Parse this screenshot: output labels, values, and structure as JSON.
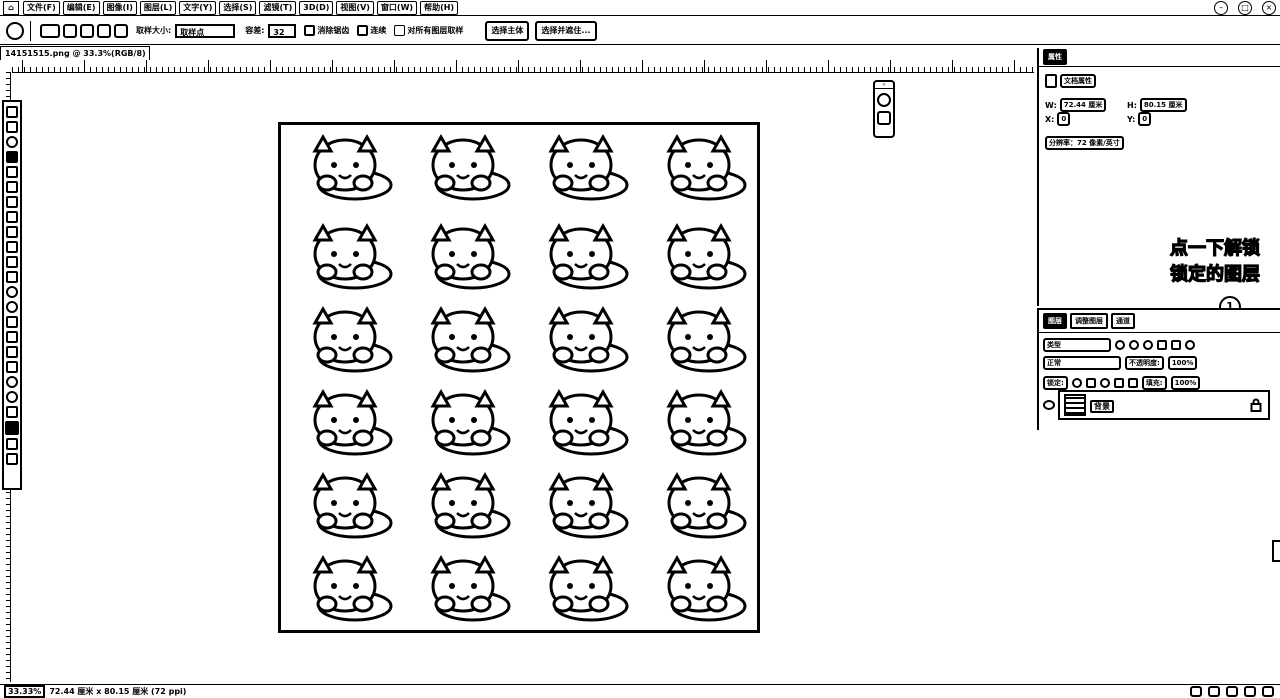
{
  "menubar": {
    "items": [
      "文件(F)",
      "编辑(E)",
      "图像(I)",
      "图层(L)",
      "文字(Y)",
      "选择(S)",
      "滤镜(T)",
      "3D(D)",
      "视图(V)",
      "窗口(W)",
      "帮助(H)"
    ]
  },
  "options": {
    "sample_label": "取样大小:",
    "sample_value": "取样点",
    "tolerance_label": "容差:",
    "tolerance_value": "32",
    "antialias_label": "消除锯齿",
    "contiguous_label": "连续",
    "all_layers_label": "对所有图层取样",
    "select_subject": "选择主体",
    "select_mask": "选择并遮住..."
  },
  "document": {
    "tab_title": "14151515.png @ 33.3%(RGB/8) *"
  },
  "properties_panel": {
    "tabs": [
      "属性"
    ],
    "section_title": "文档属性",
    "width_label": "W:",
    "width_value": "72.44 厘米",
    "height_label": "H:",
    "height_value": "80.15 厘米",
    "x_label": "X:",
    "x_value": "0",
    "y_label": "Y:",
    "y_value": "0",
    "resolution": "分辨率：72 像素/英寸"
  },
  "annotation": {
    "line1": "点一下解锁",
    "line2": "锁定的图层",
    "callout_number": "1"
  },
  "layers_panel": {
    "tabs": [
      "图层",
      "调整图层",
      "通道"
    ],
    "kind_label": "类型",
    "blend_mode": "正常",
    "opacity_label": "不透明度:",
    "opacity_value": "100%",
    "lock_label": "锁定:",
    "fill_label": "填充:",
    "fill_value": "100%",
    "layer_name": "背景"
  },
  "statusbar": {
    "zoom": "33.33%",
    "doc_info": "72.44 厘米 x 80.15 厘米 (72 ppi)"
  },
  "colors": {
    "ink": "#000000",
    "paper": "#ffffff"
  }
}
